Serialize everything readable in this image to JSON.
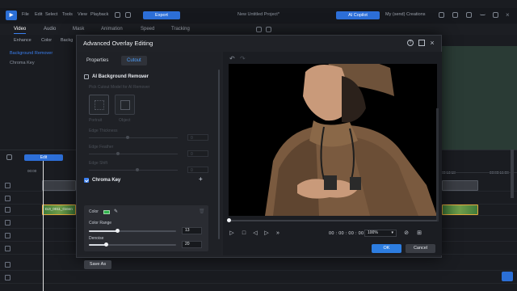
{
  "app": {
    "menu": [
      "File",
      "Edit",
      "Select",
      "Tools",
      "View",
      "Playback"
    ],
    "export_label": "Export",
    "project_title": "New Untitled Project*",
    "ai_copilot_label": "AI Copilot",
    "my_creations_label": "My (send) Creations",
    "tabs": [
      "Video",
      "Audio",
      "Mask",
      "Animation",
      "Speed",
      "Tracking"
    ],
    "subtabs": [
      "Enhance",
      "Color",
      "Backg"
    ],
    "library_items": [
      "Background Remover",
      "Chroma Key"
    ],
    "timeline_edit_label": "Edit",
    "timecode_left": "00:00",
    "timecode_mid": "00:00:13:18",
    "timecode_right": "00:00:15:00",
    "clip_label": "DJI_0011_Green"
  },
  "dialog": {
    "title": "Advanced Overlay Editing",
    "tabs": [
      {
        "label": "Properties",
        "active": false
      },
      {
        "label": "Cutout",
        "active": true
      }
    ],
    "ai_bg_remover": {
      "label": "AI Background Remover",
      "checked": false,
      "hint": "Pick Cutout Model for AI Remover",
      "modes": [
        "Portrait",
        "Object"
      ],
      "edge_thickness_label": "Edge Thickness",
      "edge_thickness_value": "0",
      "edge_feather_label": "Edge Feather",
      "edge_feather_value": "0",
      "edge_shift_label": "Edge Shift",
      "edge_shift_value": "0"
    },
    "chroma_key": {
      "label": "Chroma Key",
      "checked": true,
      "color_label": "Color",
      "color_value": "#2fb24c",
      "color_range_label": "Color Range",
      "color_range_value": "13",
      "color_range_level": 0.13,
      "denoise_label": "Denoise",
      "denoise_value": "20",
      "denoise_level": 0.2
    },
    "save_as_label": "Save As",
    "preview": {
      "timecode": "00 : 00 : 00 : 00",
      "zoom": "100%",
      "seek_level": 0.0
    },
    "ok_label": "OK",
    "cancel_label": "Cancel"
  }
}
